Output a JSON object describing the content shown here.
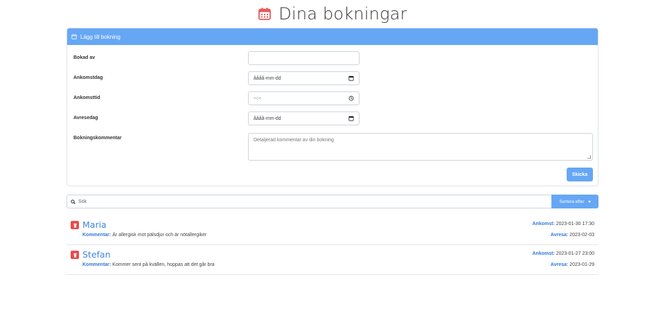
{
  "page": {
    "title": "Dina bokningar"
  },
  "form": {
    "header": "Lägg till bokning",
    "fields": [
      {
        "label": "Bokad av",
        "value": "",
        "placeholder": ""
      },
      {
        "label": "Ankomstdag",
        "placeholder": "åååå-mm-dd"
      },
      {
        "label": "Ankomsttid",
        "placeholder": "--:--"
      },
      {
        "label": "Avresedag",
        "placeholder": "åååå-mm-dd"
      },
      {
        "label": "Bokningskommentar",
        "placeholder": "Detaljerad kommentar av din bokning"
      }
    ],
    "submit_label": "Skicka"
  },
  "search": {
    "placeholder": "Sök",
    "sort_label": "Sortera efter"
  },
  "bookings": [
    {
      "name": "Maria",
      "comment_key": "Kommentar:",
      "comment": " Är allergisk mot pälsdjur och är nötallergiker",
      "arrival_key": "Ankomst:",
      "arrival": " 2023-01-30 17:30",
      "departure_key": "Avresa:",
      "departure": " 2023-02-03"
    },
    {
      "name": "Stefan",
      "comment_key": "Kommentar:",
      "comment": " Kommer sent på kvällen, hoppas att det går bra",
      "arrival_key": "Ankomst:",
      "arrival": " 2023-01-27 23:00",
      "departure_key": "Avresa:",
      "departure": " 2023-01-29"
    }
  ],
  "colors": {
    "accent": "#66a7f5",
    "link": "#3b86e3",
    "danger": "#e84c4c"
  }
}
